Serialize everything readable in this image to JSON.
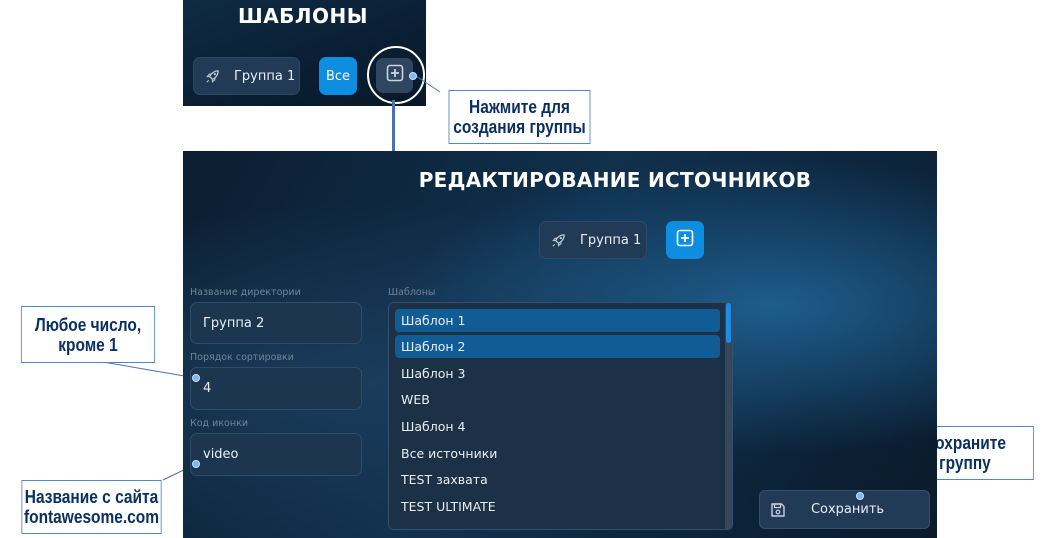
{
  "top_panel": {
    "title": "ШАБЛОНЫ",
    "group_chip": {
      "label": "Группа 1",
      "icon": "rocket-icon"
    },
    "all_button": "Все",
    "add_button": {
      "icon": "plus-square-icon"
    }
  },
  "callouts": {
    "create_group": "Нажмите для\nсоздания группы",
    "any_number": "Любое число,\nкроме 1",
    "fontawesome": "Название с сайта\nfontawesome.com",
    "save_group": "Сохраните\nгруппу"
  },
  "editor": {
    "title": "РЕДАКТИРОВАНИЕ ИСТОЧНИКОВ",
    "group_chip": {
      "label": "Группа 1",
      "icon": "rocket-icon"
    },
    "add_button": {
      "icon": "plus-square-icon"
    },
    "directory_name": {
      "label": "Название директории",
      "value": "Группа 2"
    },
    "sort_order": {
      "label": "Порядок сортировки",
      "value": "4"
    },
    "icon_code": {
      "label": "Код иконки",
      "value": "video"
    },
    "templates": {
      "label": "Шаблоны",
      "items": [
        {
          "label": "Шаблон 1",
          "selected": true
        },
        {
          "label": "Шаблон 2",
          "selected": true
        },
        {
          "label": "Шаблон 3",
          "selected": false
        },
        {
          "label": "WEB",
          "selected": false
        },
        {
          "label": "Шаблон 4",
          "selected": false
        },
        {
          "label": "Все источники",
          "selected": false
        },
        {
          "label": "TEST захвата",
          "selected": false
        },
        {
          "label": "TEST ULTIMATE",
          "selected": false
        }
      ]
    },
    "save_button": {
      "label": "Сохранить",
      "icon": "floppy-disk-icon"
    }
  },
  "colors": {
    "accent_blue": "#0e8ee0",
    "selected_row": "#125c96",
    "callout_text": "#0a3063",
    "callout_border": "#4f86c4",
    "connector": "#4d6fb8"
  }
}
